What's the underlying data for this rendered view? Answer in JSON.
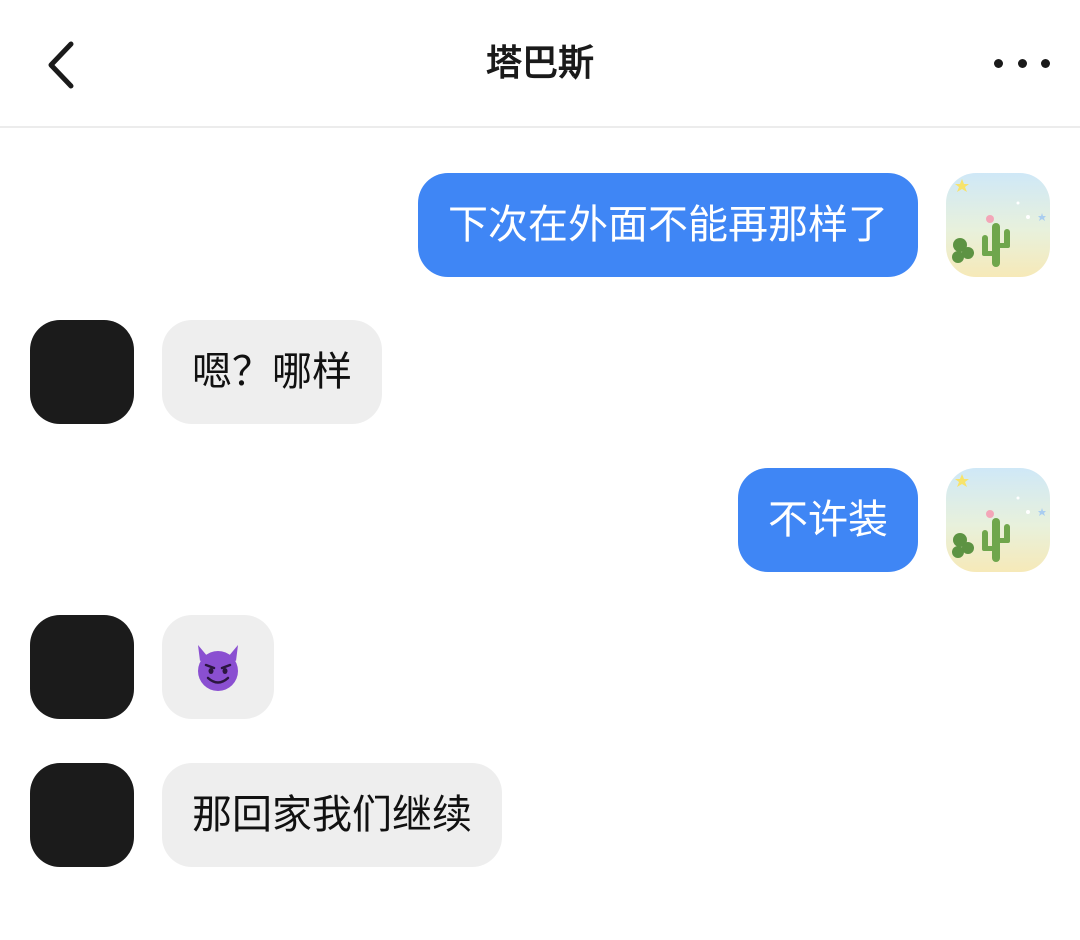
{
  "header": {
    "title": "塔巴斯",
    "back_icon": "chevron-left-icon",
    "more_icon": "more-horizontal-icon"
  },
  "messages": [
    {
      "side": "right",
      "text": "下次在外面不能再那样了",
      "avatar": "cactus-avatar"
    },
    {
      "side": "left",
      "text": "嗯？哪样",
      "avatar": "dark-avatar"
    },
    {
      "side": "right",
      "text": "不许装",
      "avatar": "cactus-avatar"
    },
    {
      "side": "left",
      "emoji": "smiling-devil-emoji",
      "avatar": "dark-avatar"
    },
    {
      "side": "left",
      "text": "那回家我们继续",
      "avatar": "dark-avatar"
    }
  ],
  "colors": {
    "outgoing_bubble": "#3f86f5",
    "incoming_bubble": "#eeeeee",
    "avatar_dark": "#1b1b1b",
    "emoji_purple": "#8a4fd1"
  }
}
